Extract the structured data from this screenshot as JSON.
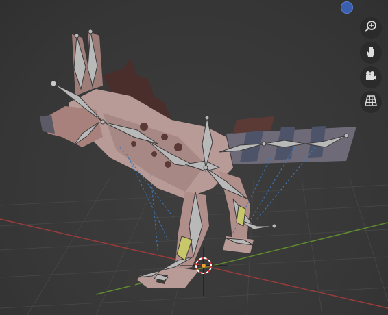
{
  "viewport": {
    "background": "#393939",
    "grid_color": "#4a4a4a",
    "x_axis_color": "#9b3b3b",
    "y_axis_color": "#5f8a2e",
    "bone_color": "#b9b9b9",
    "bone_selected_color": "#c8c86a",
    "mesh_colors": {
      "skin": "#b89a96",
      "spots": "#5b3a36",
      "mane": "#4a2e2c",
      "tail_stripe": "#4d5368"
    }
  },
  "navigation": {
    "axis_gizmo_icon": "axis-gizmo-icon",
    "buttons": [
      {
        "name": "zoom",
        "icon": "zoom-icon"
      },
      {
        "name": "pan",
        "icon": "hand-icon"
      },
      {
        "name": "camera",
        "icon": "camera-icon"
      },
      {
        "name": "perspective",
        "icon": "grid-icon"
      }
    ]
  }
}
